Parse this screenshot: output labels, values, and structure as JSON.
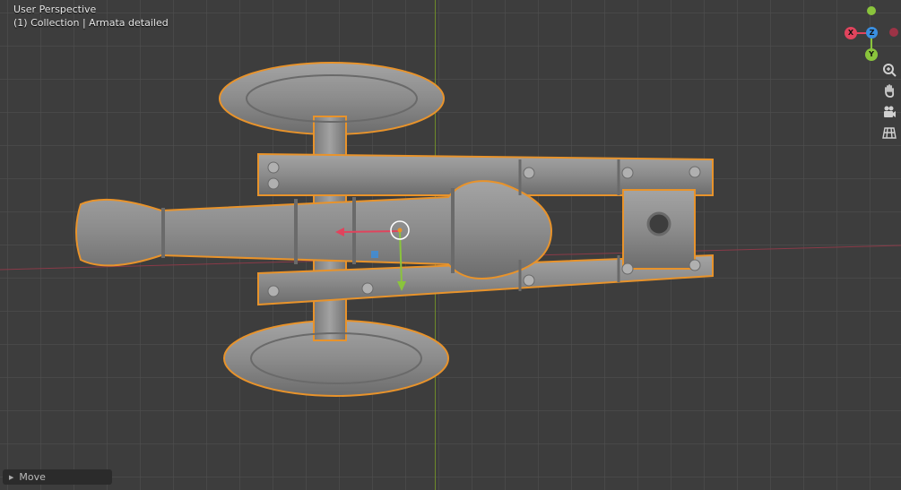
{
  "viewport": {
    "view_name": "User Perspective",
    "collection_info": "(1) Collection | Armata detailed"
  },
  "gizmo": {
    "x_label": "X",
    "y_label": "Y",
    "z_label": "Z",
    "colors": {
      "x": "#e0445d",
      "y": "#8ac43c",
      "z": "#3a8fe0"
    }
  },
  "nav_icons": [
    "zoom-icon",
    "hand-pan-icon",
    "camera-icon",
    "grid-ortho-icon"
  ],
  "operator_panel": {
    "label": "Move"
  },
  "colors": {
    "background": "#3d3d3d",
    "selection_outline": "#e8932b",
    "model": "#8a8a8a"
  }
}
